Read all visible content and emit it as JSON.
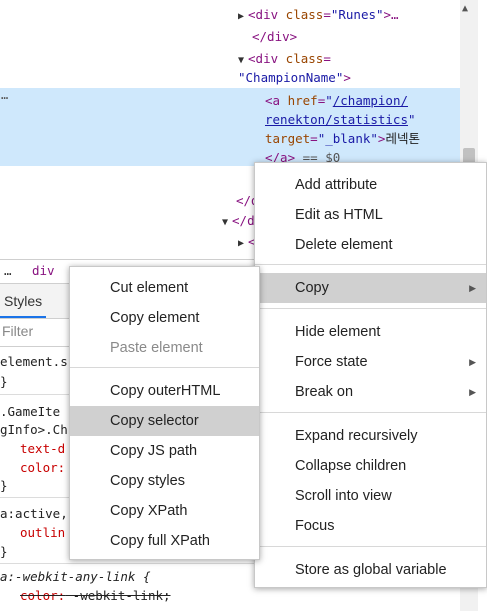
{
  "elements": {
    "lines": {
      "l1": {
        "open": "<div ",
        "attr": "class",
        "eq": "=",
        "val": "\"Runes\"",
        "close": ">…"
      },
      "l2": "</div>",
      "l3": {
        "open": "<div ",
        "attr": "class",
        "eq": "="
      },
      "l4": {
        "val": "\"ChampionName\"",
        "close": ">"
      },
      "l5": {
        "open": "<a ",
        "attr": "href",
        "eq": "=",
        "val": "\"",
        "link": "/champion/"
      },
      "l6": {
        "link": "renekton/statistics",
        "val": "\""
      },
      "l7": {
        "attr": "target",
        "eq": "=",
        "val": "\"_blank\"",
        "close": ">",
        "text": "레넥톤"
      },
      "l8": {
        "tag": "</a>",
        "marker": " == $0"
      },
      "l9": "</div>",
      "l10": "</di",
      "l11": "<"
    },
    "dots": "…"
  },
  "breadcrumb": {
    "dots": "…",
    "crumb": "div"
  },
  "styles": {
    "tab_label": "Styles",
    "filter_placeholder": "Filter",
    "rules": {
      "r1": "element.s",
      "r1b": "}",
      "r2a": ".GameIte",
      "r2b": "gInfo>.Ch",
      "r2p1": "text-d",
      "r2p2": "color:",
      "r2c": "}",
      "r3": "a:active,",
      "r3p": "outlin",
      "r3c": "}",
      "r4": "a:-webkit-any-link {",
      "r4p": "color:",
      "r4v": " -webkit-link;"
    }
  },
  "context_menu": {
    "add_attribute": "Add attribute",
    "edit_as_html": "Edit as HTML",
    "delete_element": "Delete element",
    "copy": "Copy",
    "hide_element": "Hide element",
    "force_state": "Force state",
    "break_on": "Break on",
    "expand_recursively": "Expand recursively",
    "collapse_children": "Collapse children",
    "scroll_into_view": "Scroll into view",
    "focus": "Focus",
    "store_as_global": "Store as global variable"
  },
  "copy_submenu": {
    "cut_element": "Cut element",
    "copy_element": "Copy element",
    "paste_element": "Paste element",
    "copy_outerhtml": "Copy outerHTML",
    "copy_selector": "Copy selector",
    "copy_js_path": "Copy JS path",
    "copy_styles": "Copy styles",
    "copy_xpath": "Copy XPath",
    "copy_full_xpath": "Copy full XPath"
  },
  "icons": {
    "expand": "triangle-right-icon",
    "collapse": "triangle-down-icon",
    "submenu": "submenu-arrow-icon"
  },
  "colors": {
    "selection": "#cfe8fc",
    "menu_highlight": "#d0d0d0",
    "tag": "#881280",
    "attr": "#994500",
    "value": "#1a1aa6"
  }
}
